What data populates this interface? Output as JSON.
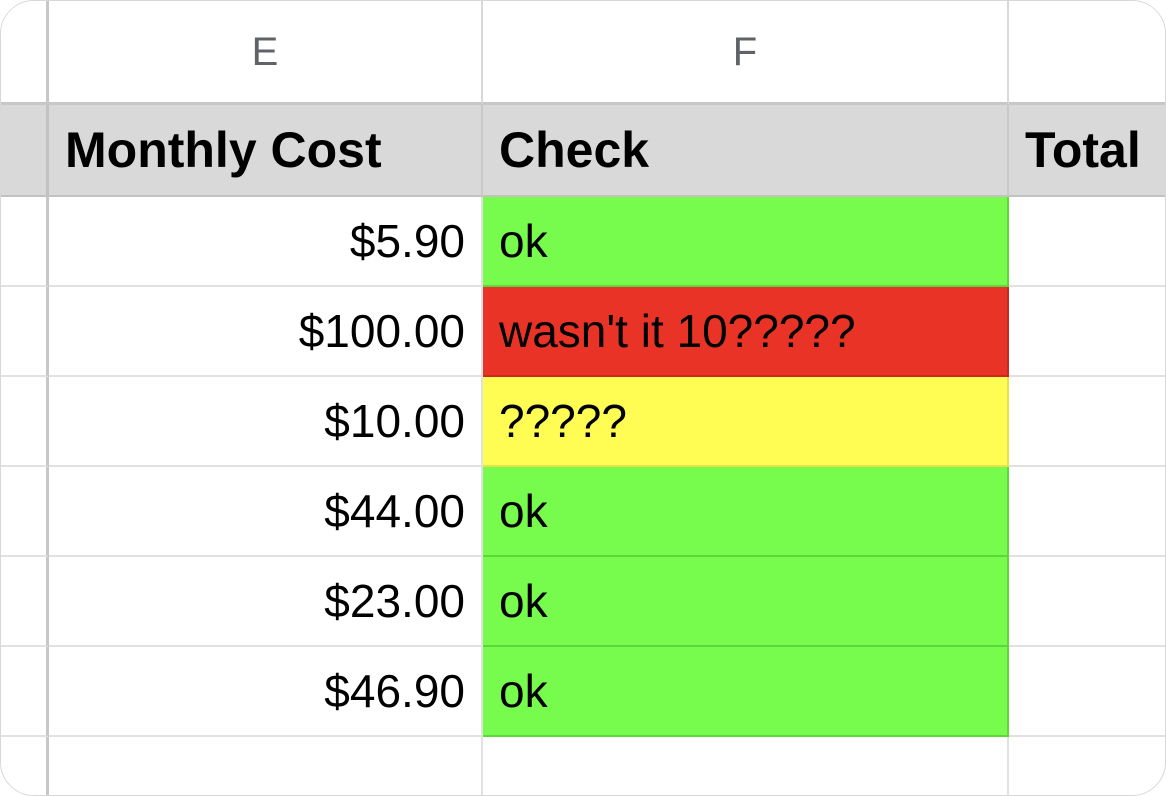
{
  "columns": {
    "e": "E",
    "f": "F"
  },
  "header_row": {
    "monthly_cost": "Monthly Cost",
    "check": "Check",
    "total": "Total"
  },
  "rows": [
    {
      "cost": "$5.90",
      "check": "ok",
      "status": "ok",
      "color": "#77fb4c"
    },
    {
      "cost": "$100.00",
      "check": "wasn't it 10?????",
      "status": "bad",
      "color": "#e93327"
    },
    {
      "cost": "$10.00",
      "check": "?????",
      "status": "warn",
      "color": "#fffd54"
    },
    {
      "cost": "$44.00",
      "check": "ok",
      "status": "ok",
      "color": "#77fb4c"
    },
    {
      "cost": "$23.00",
      "check": "ok",
      "status": "ok",
      "color": "#77fb4c"
    },
    {
      "cost": "$46.90",
      "check": "ok",
      "status": "ok",
      "color": "#77fb4c"
    }
  ]
}
